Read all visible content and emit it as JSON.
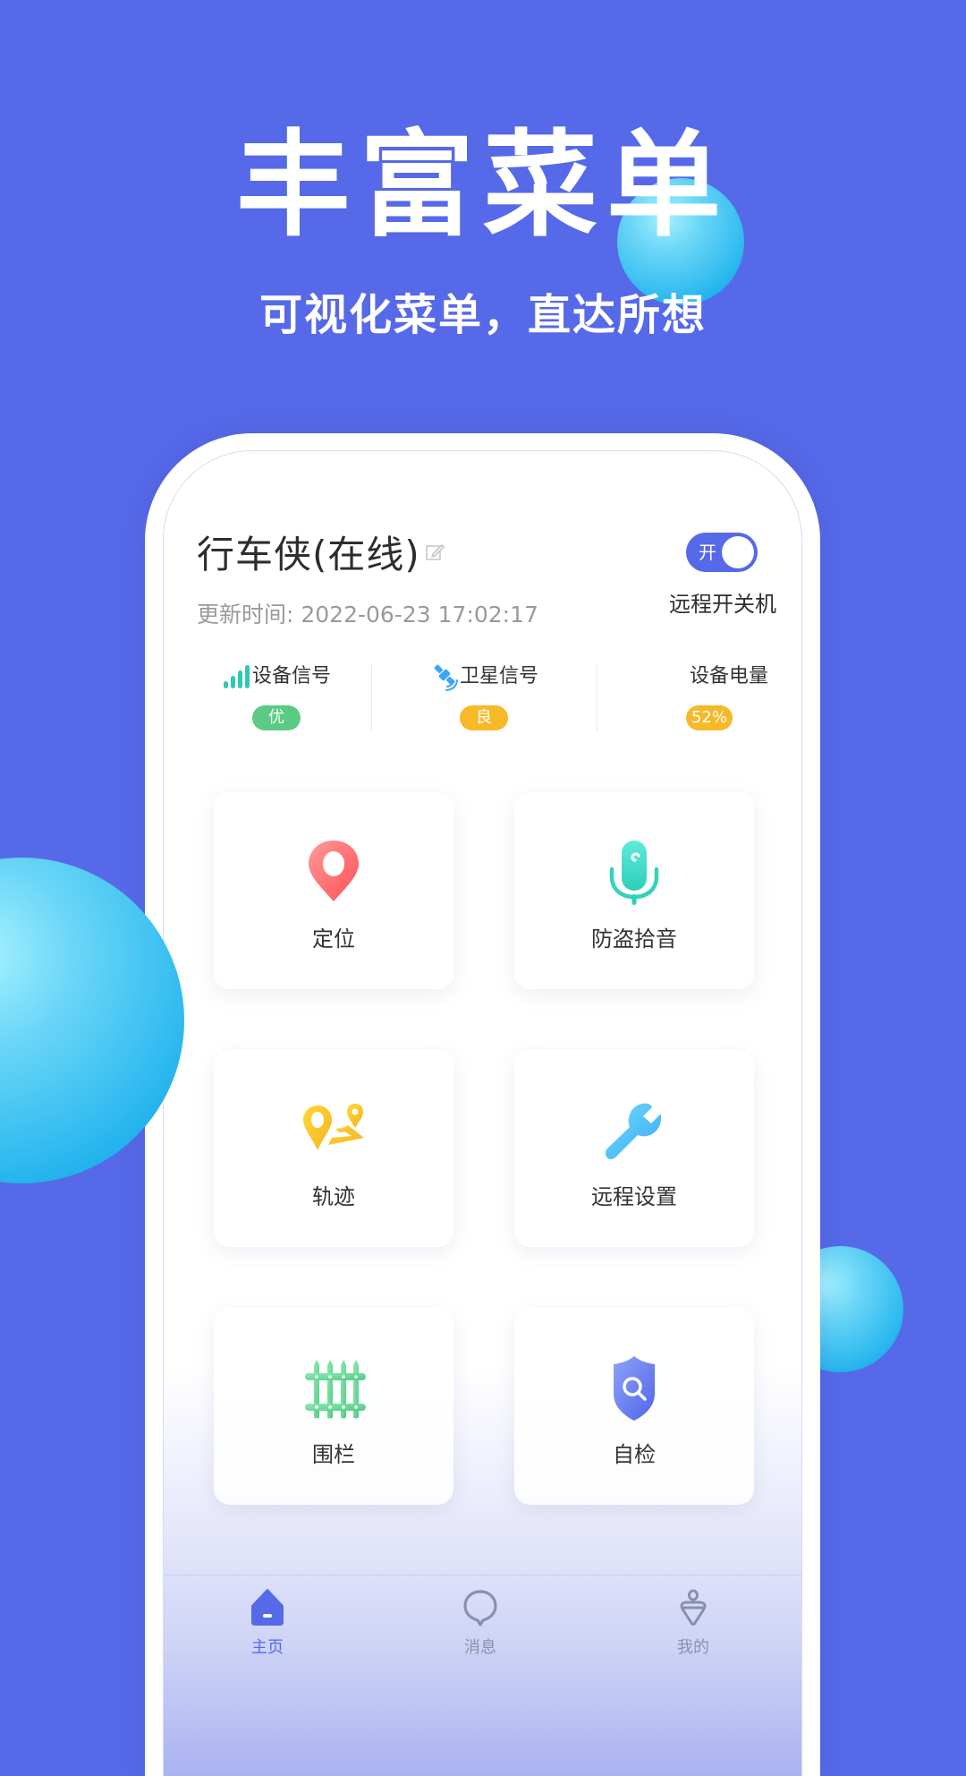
{
  "promo": {
    "title": "丰富菜单",
    "subtitle": "可视化菜单，直达所想"
  },
  "device": {
    "name": "行车侠(在线)",
    "update_time": "更新时间: 2022-06-23 17:02:17",
    "power_toggle": {
      "state_label": "开",
      "on": true,
      "caption": "远程开关机"
    }
  },
  "stats": [
    {
      "icon": "signal-bars-icon",
      "label": "设备信号",
      "value": "优",
      "badge_color": "#5acb84"
    },
    {
      "icon": "satellite-icon",
      "label": "卫星信号",
      "value": "良",
      "badge_color": "#f7b928"
    },
    {
      "icon": "",
      "label": "设备电量",
      "value": "52%",
      "badge_color": "#f7b928"
    }
  ],
  "menu": [
    {
      "icon": "location-pin-icon",
      "label": "定位"
    },
    {
      "icon": "microphone-icon",
      "label": "防盗拾音"
    },
    {
      "icon": "track-route-icon",
      "label": "轨迹"
    },
    {
      "icon": "wrench-icon",
      "label": "远程设置"
    },
    {
      "icon": "fence-icon",
      "label": "围栏"
    },
    {
      "icon": "shield-search-icon",
      "label": "自检"
    }
  ],
  "nav": [
    {
      "icon": "home-icon",
      "label": "主页",
      "active": true
    },
    {
      "icon": "message-bubble-icon",
      "label": "消息",
      "active": false
    },
    {
      "icon": "profile-icon",
      "label": "我的",
      "active": false
    }
  ],
  "colors": {
    "background": "#5669e8",
    "accent": "#5669e8",
    "nav_inactive": "#8a90ac",
    "sphere": "#35bdf0"
  }
}
